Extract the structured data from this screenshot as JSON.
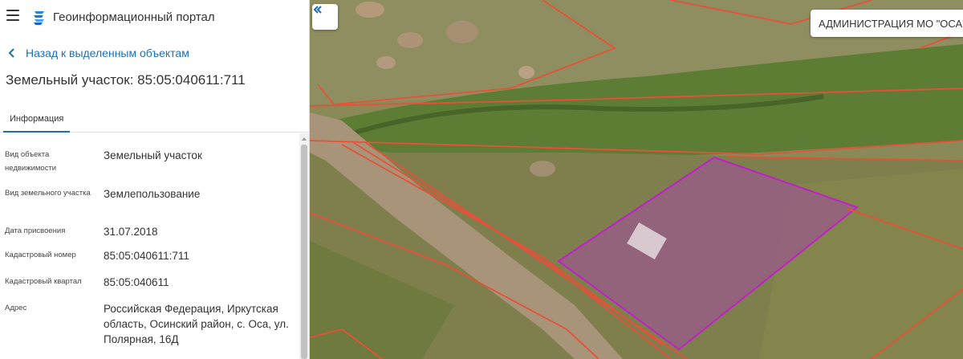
{
  "header": {
    "menu_icon": "hamburger-menu-icon",
    "logo_icon": "geoportal-logo-icon",
    "app_title": "Геоинформационный портал"
  },
  "back_link": {
    "icon": "chevron-left-icon",
    "label": "Назад к выделенным объектам"
  },
  "page_title": "Земельный участок: 85:05:040611:711",
  "tabs": [
    {
      "label": "Информация",
      "active": true
    }
  ],
  "info": {
    "rows": [
      {
        "key": "Вид объекта недвижимости",
        "value": "Земельный участок"
      },
      {
        "key": "Вид земельного участка",
        "value": "Землепользование"
      },
      {
        "key": "Дата присвоения",
        "value": "31.07.2018"
      },
      {
        "key": "Кадастровый номер",
        "value": "85:05:040611:711"
      },
      {
        "key": "Кадастровый квартал",
        "value": "85:05:040611"
      },
      {
        "key": "Адрес",
        "value": "Российская Федерация, Иркутская область, Осинский район, с. Оса, ул. Полярная, 16Д"
      }
    ]
  },
  "map": {
    "collapse_icon": "double-chevron-left-icon",
    "admin_label": "АДМИНИСТРАЦИЯ МО \"ОСА\"",
    "parcel_border_color": "#e8503a",
    "selected_parcel_color": "#c020c8"
  },
  "colors": {
    "accent": "#1d6fb8",
    "text": "#333333"
  }
}
